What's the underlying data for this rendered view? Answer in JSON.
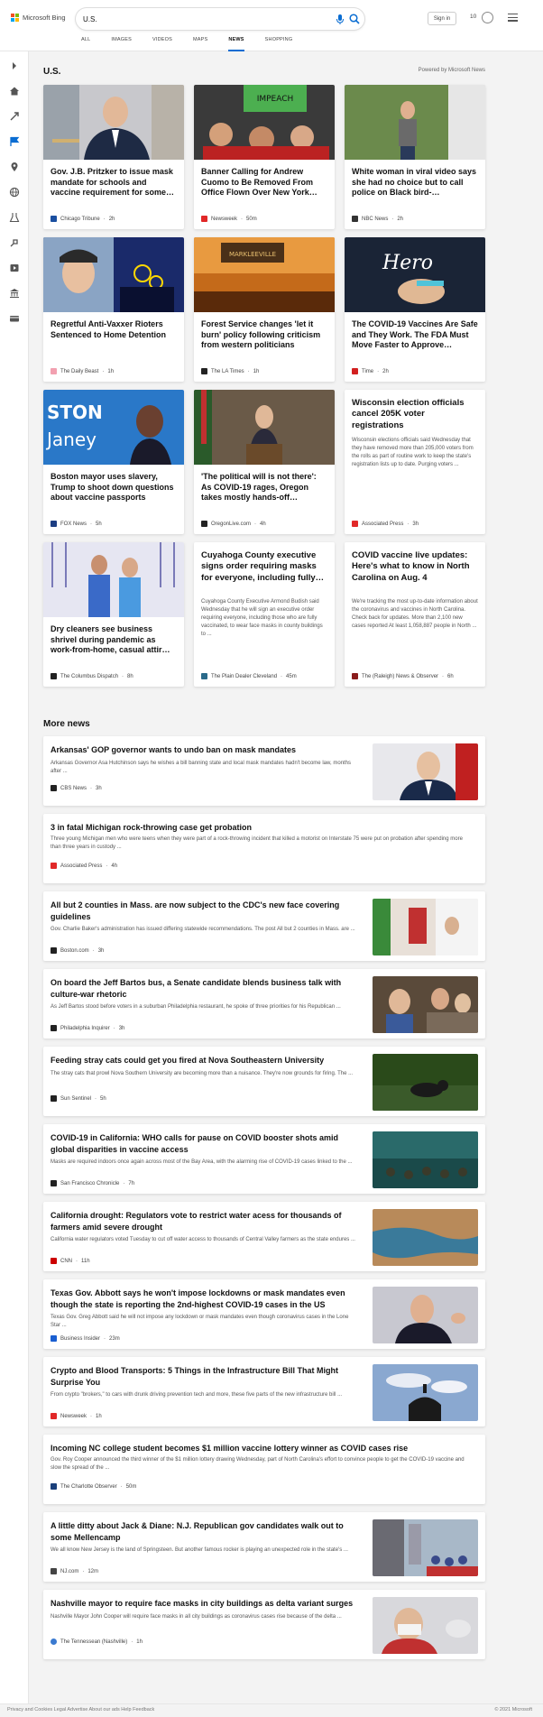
{
  "header": {
    "logo_text": "Microsoft Bing",
    "search_value": "U.S.",
    "signin": "Sign in",
    "points": "10",
    "tabs": [
      "ALL",
      "IMAGES",
      "VIDEOS",
      "MAPS",
      "NEWS",
      "SHOPPING"
    ],
    "active_tab": "NEWS"
  },
  "section": {
    "title": "U.S.",
    "powered": "Powered by Microsoft News"
  },
  "cards": [
    {
      "title": "Gov. J.B. Pritzker to issue mask mandate for schools and vaccine requirement for some…",
      "source": "Chicago Tribune",
      "time": "2h",
      "src_color": "#1a4fa0"
    },
    {
      "title": "Banner Calling for Andrew Cuomo to Be Removed From Office Flown Over New York…",
      "source": "Newsweek",
      "time": "50m",
      "src_color": "#e12828"
    },
    {
      "title": "White woman in viral video says she had no choice but to call police on Black bird-…",
      "source": "NBC News",
      "time": "2h",
      "src_color": "#333333"
    },
    {
      "title": "Regretful Anti-Vaxxer Rioters Sentenced to Home Detention",
      "source": "The Daily Beast",
      "time": "1h",
      "src_color": "#f2a0b0"
    },
    {
      "title": "Forest Service changes 'let it burn' policy following criticism from western politicians",
      "source": "The LA Times",
      "time": "1h",
      "src_color": "#222222"
    },
    {
      "title": "The COVID-19 Vaccines Are Safe and They Work. The FDA Must Move Faster to Approve…",
      "source": "Time",
      "time": "2h",
      "src_color": "#d21f1f"
    },
    {
      "title": "Boston mayor uses slavery, Trump to shoot down questions about vaccine passports",
      "source": "FOX News",
      "time": "5h",
      "src_color": "#1c3d82"
    },
    {
      "title": "'The political will is not there': As COVID-19 rages, Oregon takes mostly hands-off…",
      "source": "OregonLive.com",
      "time": "4h",
      "src_color": "#222222"
    },
    {
      "title": "Wisconsin election officials cancel 205K voter registrations",
      "snippet": "Wisconsin elections officials said Wednesday that they have removed more than 205,000 voters from the rolls as part of routine work to keep the state's registration lists up to date. Purging voters ...",
      "source": "Associated Press",
      "time": "3h",
      "src_color": "#e12828"
    },
    {
      "title": "Dry cleaners see business shrivel during pandemic as work-from-home, casual attir…",
      "source": "The Columbus Dispatch",
      "time": "8h",
      "src_color": "#222222"
    },
    {
      "title": "Cuyahoga County executive signs order requiring masks for everyone, including fully…",
      "snippet": "Cuyahoga County Executive Armond Budish said Wednesday that he will sign an executive order requiring everyone, including those who are fully vaccinated, to wear face masks in county buildings to ...",
      "source": "The Plain Dealer Cleveland",
      "time": "45m",
      "src_color": "#2a6a8a"
    },
    {
      "title": "COVID vaccine live updates: Here's what to know in North Carolina on Aug. 4",
      "snippet": "We're tracking the most up-to-date information about the coronavirus and vaccines in North Carolina. Check back for updates. More than 2,100 new cases reported At least 1,058,887 people in North ...",
      "source": "The (Raleigh) News & Observer",
      "time": "6h",
      "src_color": "#8a1c1c"
    }
  ],
  "more_news": {
    "title": "More news",
    "items": [
      {
        "title": "Arkansas' GOP governor wants to undo ban on mask mandates",
        "snippet": "Arkansas Governor Asa Hutchinson says he wishes a bill banning state and local mask mandates hadn't become law, months after ...",
        "source": "CBS News",
        "time": "3h",
        "src_color": "#222222"
      },
      {
        "title": "3 in fatal Michigan rock-throwing case get probation",
        "snippet": "Three young Michigan men who were teens when they were part of a rock-throwing incident that killed a motorist on Interstate 75 were put on probation after spending more than three years in custody ...",
        "source": "Associated Press",
        "time": "4h",
        "src_color": "#e12828"
      },
      {
        "title": "All but 2 counties in Mass. are now subject to the CDC's new face covering guidelines",
        "snippet": "Gov. Charlie Baker's administration has issued differing statewide recommendations. The post All but 2 counties in Mass. are ...",
        "source": "Boston.com",
        "time": "3h",
        "src_color": "#222222"
      },
      {
        "title": "On board the Jeff Bartos bus, a Senate candidate blends business talk with culture-war rhetoric",
        "snippet": "As Jeff Bartos stood before voters in a suburban Philadelphia restaurant, he spoke of three priorities for his Republican ...",
        "source": "Philadelphia Inquirer",
        "time": "3h",
        "src_color": "#222222"
      },
      {
        "title": "Feeding stray cats could get you fired at Nova Southeastern University",
        "snippet": "The stray cats that prowl Nova Southern University are becoming more than a nuisance. They're now grounds for firing. The ...",
        "source": "Sun Sentinel",
        "time": "5h",
        "src_color": "#222222"
      },
      {
        "title": "COVID-19 in California: WHO calls for pause on COVID booster shots amid global disparities in vaccine access",
        "snippet": "Masks are required indoors once again across most of the Bay Area, with the alarming rise of COVID-19 cases linked to the ...",
        "source": "San Francisco Chronicle",
        "time": "7h",
        "src_color": "#222222"
      },
      {
        "title": "California drought: Regulators vote to restrict water acess for thousands of farmers amid severe drought",
        "snippet": "California water regulators voted Tuesday to cut off water access to thousands of Central Valley farmers as the state endures ...",
        "source": "CNN",
        "time": "11h",
        "src_color": "#cc0000"
      },
      {
        "title": "Texas Gov. Abbott says he won't impose lockdowns or mask mandates even though the state is reporting the 2nd-highest COVID-19 cases in the US",
        "snippet": "Texas Gov. Greg Abbott said he will not impose any lockdown or mask mandates even though coronavirus cases in the Lone Star ...",
        "source": "Business Insider",
        "time": "23m",
        "src_color": "#1a5fd1"
      },
      {
        "title": "Crypto and Blood Transports: 5 Things in the Infrastructure Bill That Might Surprise You",
        "snippet": "From crypto \"brokers,\" to cars with drunk driving prevention tech and more, these five parts of the new infrastructure bill ...",
        "source": "Newsweek",
        "time": "1h",
        "src_color": "#e12828"
      },
      {
        "title": "Incoming NC college student becomes $1 million vaccine lottery winner as COVID cases rise",
        "snippet": "Gov. Roy Cooper announced the third winner of the $1 million lottery drawing Wednesday, part of North Carolina's effort to convince people to get the COVID-19 vaccine and slow the spread of the ...",
        "source": "The Charlotte Observer",
        "time": "50m",
        "src_color": "#1a3f7a"
      },
      {
        "title": "A little ditty about Jack & Diane: N.J. Republican gov candidates walk out to some Mellencamp",
        "snippet": "We all know New Jersey is the land of Springsteen. But another famous rocker is playing an unexpected role in the state's ...",
        "source": "NJ.com",
        "time": "12m",
        "src_color": "#444444"
      },
      {
        "title": "Nashville mayor to require face masks in city buildings as delta variant surges",
        "snippet": "Nashville Mayor John Cooper will require face masks in all city buildings as coronavirus cases rise because of the delta ...",
        "source": "The Tennessean (Nashville)",
        "time": "1h",
        "src_color": "#3a7ad0"
      }
    ]
  },
  "footer": {
    "left": "Privacy and Cookies   Legal   Advertise   About our ads   Help   Feedback",
    "right": "© 2021 Microsoft"
  },
  "colors": {
    "accent": "#0a6dd2",
    "ms_red": "#f25022",
    "ms_green": "#7fba00",
    "ms_blue": "#00a4ef",
    "ms_yellow": "#ffb900"
  }
}
